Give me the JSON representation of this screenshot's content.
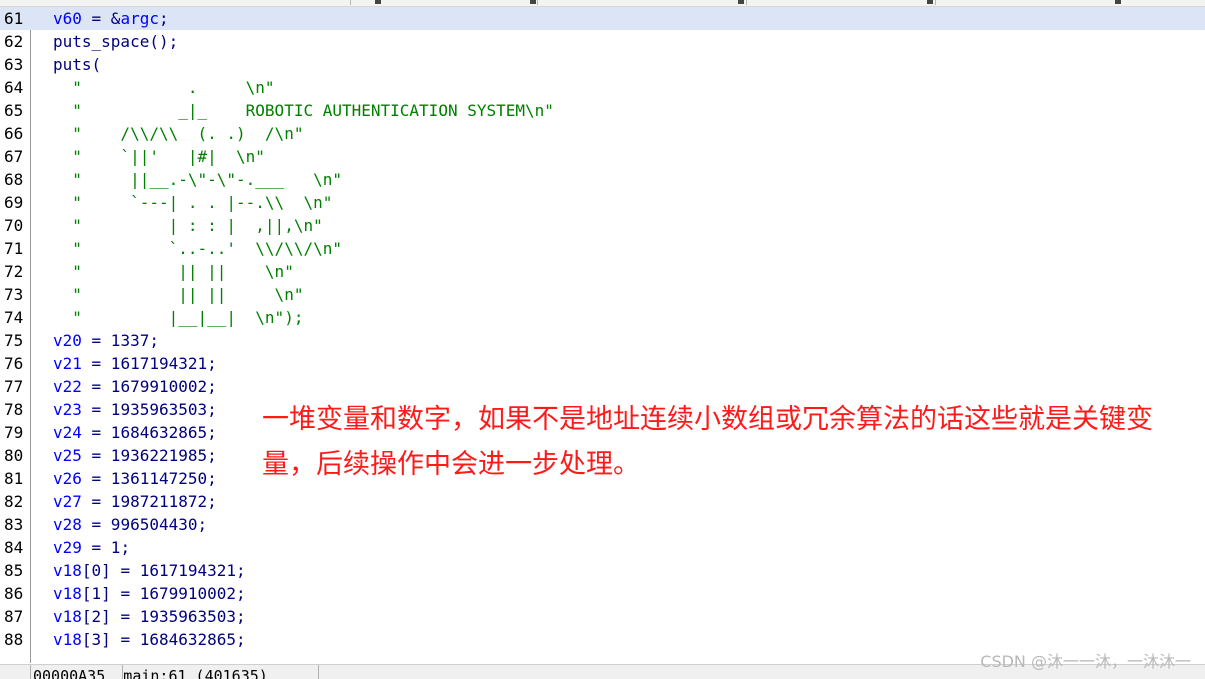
{
  "status_bar": {
    "position": "00000A35  main:61 (401635)"
  },
  "annotation": {
    "text": "一堆变量和数字，如果不是地址连续小数组或冗余算法的话这些就是关键变量，后续操作中会进一步处理。"
  },
  "watermark": {
    "text": "CSDN @沐一一沐，一沐沐一"
  },
  "code_lines": [
    {
      "n": "61",
      "segments": [
        {
          "t": "v60",
          "c": "var"
        },
        {
          "t": " = &",
          "c": "plain"
        },
        {
          "t": "argc",
          "c": "var"
        },
        {
          "t": ";",
          "c": "plain"
        }
      ]
    },
    {
      "n": "62",
      "segments": [
        {
          "t": "puts_space();",
          "c": "plain"
        }
      ]
    },
    {
      "n": "63",
      "segments": [
        {
          "t": "puts(",
          "c": "plain"
        }
      ]
    },
    {
      "n": "64",
      "segments": [
        {
          "t": "  \"           .     \\n\"",
          "c": "str"
        }
      ]
    },
    {
      "n": "65",
      "segments": [
        {
          "t": "  \"          _|_    ROBOTIC AUTHENTICATION SYSTEM\\n\"",
          "c": "str"
        }
      ]
    },
    {
      "n": "66",
      "segments": [
        {
          "t": "  \"    /\\\\/\\\\  (. .)  /\\n\"",
          "c": "str"
        }
      ]
    },
    {
      "n": "67",
      "segments": [
        {
          "t": "  \"    `||'   |#|  \\n\"",
          "c": "str"
        }
      ]
    },
    {
      "n": "68",
      "segments": [
        {
          "t": "  \"     ||__.-\\\"-\\\"-.___   \\n\"",
          "c": "str"
        }
      ]
    },
    {
      "n": "69",
      "segments": [
        {
          "t": "  \"     `---| . . |--.\\\\  \\n\"",
          "c": "str"
        }
      ]
    },
    {
      "n": "70",
      "segments": [
        {
          "t": "  \"         | : : |  ,||,\\n\"",
          "c": "str"
        }
      ]
    },
    {
      "n": "71",
      "segments": [
        {
          "t": "  \"         `..-..'  \\\\/\\\\/\\n\"",
          "c": "str"
        }
      ]
    },
    {
      "n": "72",
      "segments": [
        {
          "t": "  \"          || ||    \\n\"",
          "c": "str"
        }
      ]
    },
    {
      "n": "73",
      "segments": [
        {
          "t": "  \"          || ||     \\n\"",
          "c": "str"
        }
      ]
    },
    {
      "n": "74",
      "segments": [
        {
          "t": "  \"         |__|__|  \\n\");",
          "c": "str"
        }
      ]
    },
    {
      "n": "75",
      "segments": [
        {
          "t": "v20",
          "c": "var"
        },
        {
          "t": " = 1337;",
          "c": "plain"
        }
      ]
    },
    {
      "n": "76",
      "segments": [
        {
          "t": "v21",
          "c": "var"
        },
        {
          "t": " = 1617194321;",
          "c": "plain"
        }
      ]
    },
    {
      "n": "77",
      "segments": [
        {
          "t": "v22",
          "c": "var"
        },
        {
          "t": " = 1679910002;",
          "c": "plain"
        }
      ]
    },
    {
      "n": "78",
      "segments": [
        {
          "t": "v23",
          "c": "var"
        },
        {
          "t": " = 1935963503;",
          "c": "plain"
        }
      ]
    },
    {
      "n": "79",
      "segments": [
        {
          "t": "v24",
          "c": "var"
        },
        {
          "t": " = 1684632865;",
          "c": "plain"
        }
      ]
    },
    {
      "n": "80",
      "segments": [
        {
          "t": "v25",
          "c": "var"
        },
        {
          "t": " = 1936221985;",
          "c": "plain"
        }
      ]
    },
    {
      "n": "81",
      "segments": [
        {
          "t": "v26",
          "c": "var"
        },
        {
          "t": " = 1361147250;",
          "c": "plain"
        }
      ]
    },
    {
      "n": "82",
      "segments": [
        {
          "t": "v27",
          "c": "var"
        },
        {
          "t": " = 1987211872;",
          "c": "plain"
        }
      ]
    },
    {
      "n": "83",
      "segments": [
        {
          "t": "v28",
          "c": "var"
        },
        {
          "t": " = 996504430;",
          "c": "plain"
        }
      ]
    },
    {
      "n": "84",
      "segments": [
        {
          "t": "v29",
          "c": "var"
        },
        {
          "t": " = 1;",
          "c": "plain"
        }
      ]
    },
    {
      "n": "85",
      "segments": [
        {
          "t": "v18",
          "c": "var"
        },
        {
          "t": "[0] = 1617194321;",
          "c": "plain"
        }
      ]
    },
    {
      "n": "86",
      "segments": [
        {
          "t": "v18",
          "c": "var"
        },
        {
          "t": "[1] = 1679910002;",
          "c": "plain"
        }
      ]
    },
    {
      "n": "87",
      "segments": [
        {
          "t": "v18",
          "c": "var"
        },
        {
          "t": "[2] = 1935963503;",
          "c": "plain"
        }
      ]
    },
    {
      "n": "88",
      "segments": [
        {
          "t": "v18",
          "c": "var"
        },
        {
          "t": "[3] = 1684632865;",
          "c": "plain"
        }
      ]
    }
  ],
  "current_line": "61"
}
